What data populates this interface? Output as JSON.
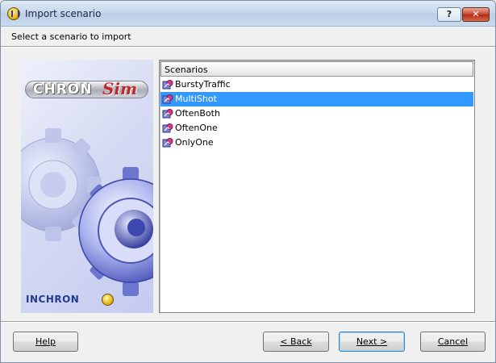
{
  "window": {
    "title": "Import scenario"
  },
  "titlebar_buttons": {
    "help": "?",
    "close": "✕"
  },
  "header": {
    "instruction": "Select a scenario to import"
  },
  "banner": {
    "product_name": "CHRON",
    "product_accent": "Sim",
    "brand": "INCHRON"
  },
  "list": {
    "column_header": "Scenarios",
    "items": [
      {
        "label": "BurstyTraffic",
        "selected": false
      },
      {
        "label": "MultiShot",
        "selected": true
      },
      {
        "label": "OftenBoth",
        "selected": false
      },
      {
        "label": "OftenOne",
        "selected": false
      },
      {
        "label": "OnlyOne",
        "selected": false
      }
    ]
  },
  "buttons": {
    "help": "Help",
    "back": "< Back",
    "next": "Next >",
    "cancel": "Cancel"
  },
  "colors": {
    "selection": "#3399ff",
    "brand_blue": "#243a8e",
    "accent_red": "#c0282b"
  }
}
